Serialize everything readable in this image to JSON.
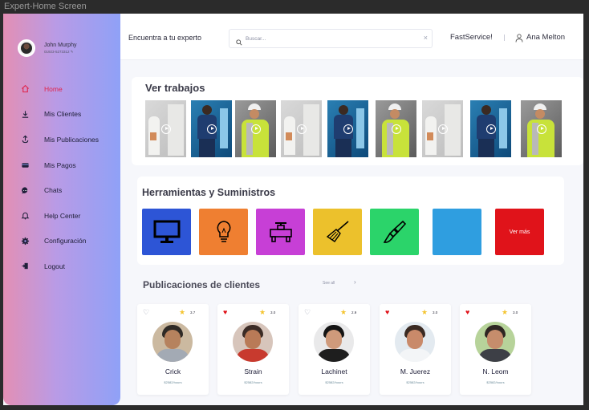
{
  "window_title": "Expert-Home Screen",
  "profile": {
    "name": "John Murphy",
    "phone": "01923-5273312"
  },
  "nav": [
    {
      "label": "Home",
      "icon": "home-icon",
      "active": true
    },
    {
      "label": "Mis Clientes",
      "icon": "download-icon"
    },
    {
      "label": "Mis Publicaciones",
      "icon": "upload-icon"
    },
    {
      "label": "Mis Pagos",
      "icon": "wallet-icon"
    },
    {
      "label": "Chats",
      "icon": "chat-icon"
    },
    {
      "label": "Help Center",
      "icon": "bell-icon"
    },
    {
      "label": "Configuración",
      "icon": "gear-icon"
    },
    {
      "label": "Logout",
      "icon": "logout-icon"
    }
  ],
  "header": {
    "title": "Encuentra a tu experto",
    "search_placeholder": "Buscar...",
    "brand": "FastService!",
    "user": "Ana Melton"
  },
  "jobs": {
    "title": "Ver trabajos",
    "videos": [
      "video 1",
      "video 2",
      "video 3",
      "video 4",
      "video 5",
      "video 6",
      "video 7",
      "video 8",
      "video 9"
    ]
  },
  "tools": {
    "title": "Herramientas y Suministros",
    "items": [
      {
        "icon": "monitor-icon",
        "color": "#2d55d6"
      },
      {
        "icon": "lightbulb-icon",
        "color": "#ef7f31"
      },
      {
        "icon": "pipe-icon",
        "color": "#c73fd6"
      },
      {
        "icon": "broom-icon",
        "color": "#ecc12c"
      },
      {
        "icon": "paint-brush-icon",
        "color": "#2bd46a"
      },
      {
        "icon": "",
        "color": "#2f9ee0"
      },
      {
        "icon": "",
        "color": "#e0131a",
        "label": "Ver más"
      }
    ]
  },
  "publications": {
    "title": "Publicaciones de clientes",
    "see_all": "See all",
    "clients": [
      {
        "name": "Crick",
        "rating": "3.7",
        "price": "$2582/hours",
        "liked": false
      },
      {
        "name": "Strain",
        "rating": "3.0",
        "price": "$2582/hours",
        "liked": true
      },
      {
        "name": "Lachinet",
        "rating": "2.9",
        "price": "$2582/hours",
        "liked": false
      },
      {
        "name": "M. Juerez",
        "rating": "3.0",
        "price": "$2582/hours",
        "liked": true
      },
      {
        "name": "N. Leom",
        "rating": "3.0",
        "price": "$2582/hours",
        "liked": true
      }
    ]
  }
}
